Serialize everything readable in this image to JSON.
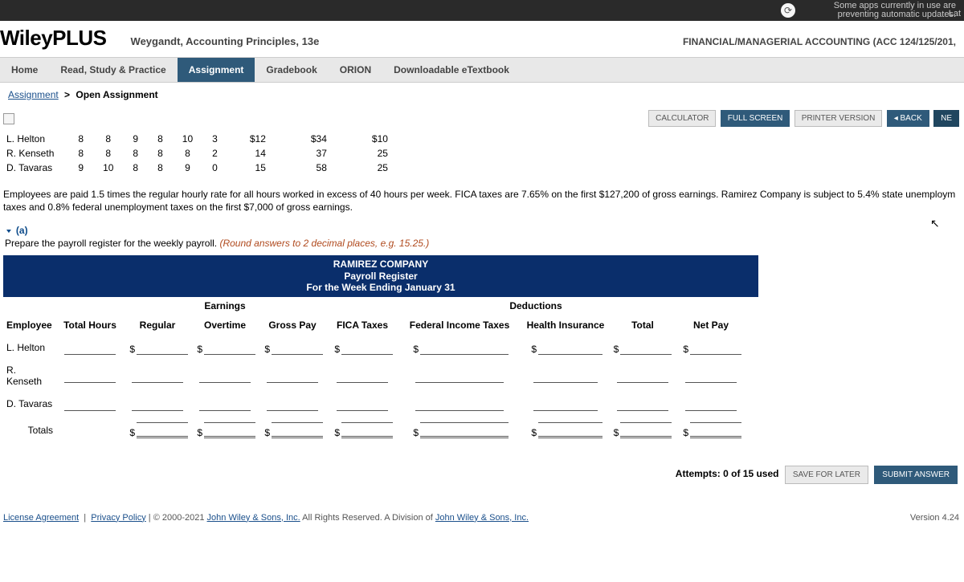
{
  "banner": {
    "line1": "Some apps currently in use are",
    "line2": "preventing automatic updates.",
    "right_trunc": "Lat"
  },
  "brand": "WileyPLUS",
  "course_title": "Weygandt, Accounting Principles, 13e",
  "course_right": "FINANCIAL/MANAGERIAL ACCOUNTING (ACC 124/125/201,",
  "nav": {
    "home": "Home",
    "rsp": "Read, Study & Practice",
    "assignment": "Assignment",
    "gradebook": "Gradebook",
    "orion": "ORION",
    "etext": "Downloadable eTextbook"
  },
  "breadcrumb": {
    "link": "Assignment",
    "sep": ">",
    "current": "Open Assignment"
  },
  "tools": {
    "calculator": "CALCULATOR",
    "full_screen": "FULL SCREEN",
    "printer": "PRINTER VERSION",
    "back": "◂ BACK",
    "next": "NE"
  },
  "hours": {
    "rows": [
      {
        "name": "L. Helton",
        "d": [
          "8",
          "8",
          "9",
          "8",
          "10",
          "3"
        ],
        "rate": "$12",
        "gross": "$34",
        "fed": "$10"
      },
      {
        "name": "R. Kenseth",
        "d": [
          "8",
          "8",
          "8",
          "8",
          "8",
          "2"
        ],
        "rate": "14",
        "gross": "37",
        "fed": "25"
      },
      {
        "name": "D. Tavaras",
        "d": [
          "9",
          "10",
          "8",
          "8",
          "9",
          "0"
        ],
        "rate": "15",
        "gross": "58",
        "fed": "25"
      }
    ]
  },
  "problem_text": "Employees are paid 1.5 times the regular hourly rate for all hours worked in excess of 40 hours per week. FICA taxes are 7.65% on the first $127,200 of gross earnings. Ramirez Company is subject to 5.4% state unemploym  taxes and 0.8% federal unemployment taxes on the first $7,000 of gross earnings.",
  "part": {
    "label": "(a)",
    "instr_plain": "Prepare the payroll register for the weekly payroll. ",
    "instr_hint": "(Round answers to 2 decimal places, e.g. 15.25.)"
  },
  "register": {
    "title_l1": "RAMIREZ COMPANY",
    "title_l2": "Payroll Register",
    "title_l3": "For the Week Ending January 31",
    "cat_earnings": "Earnings",
    "cat_deductions": "Deductions",
    "cols": {
      "employee": "Employee",
      "total_hours": "Total Hours",
      "regular": "Regular",
      "overtime": "Overtime",
      "gross": "Gross Pay",
      "fica": "FICA Taxes",
      "federal": "Federal Income Taxes",
      "health": "Health Insurance",
      "total": "Total",
      "net": "Net Pay"
    },
    "emp": [
      "L. Helton",
      "R. Kenseth",
      "D. Tavaras"
    ],
    "totals_label": "Totals",
    "dollar": "$"
  },
  "attempts": "Attempts: 0 of 15 used",
  "actions": {
    "save": "SAVE FOR LATER",
    "submit": "SUBMIT ANSWER"
  },
  "footer": {
    "license": "License Agreement",
    "privacy": "Privacy Policy",
    "copyright_pre": " | © 2000-2021 ",
    "copyright_link": "John Wiley & Sons, Inc.",
    "copyright_mid": " All Rights Reserved. A Division of ",
    "copyright_link2": "John Wiley & Sons, Inc.",
    "version": "Version 4.24"
  }
}
